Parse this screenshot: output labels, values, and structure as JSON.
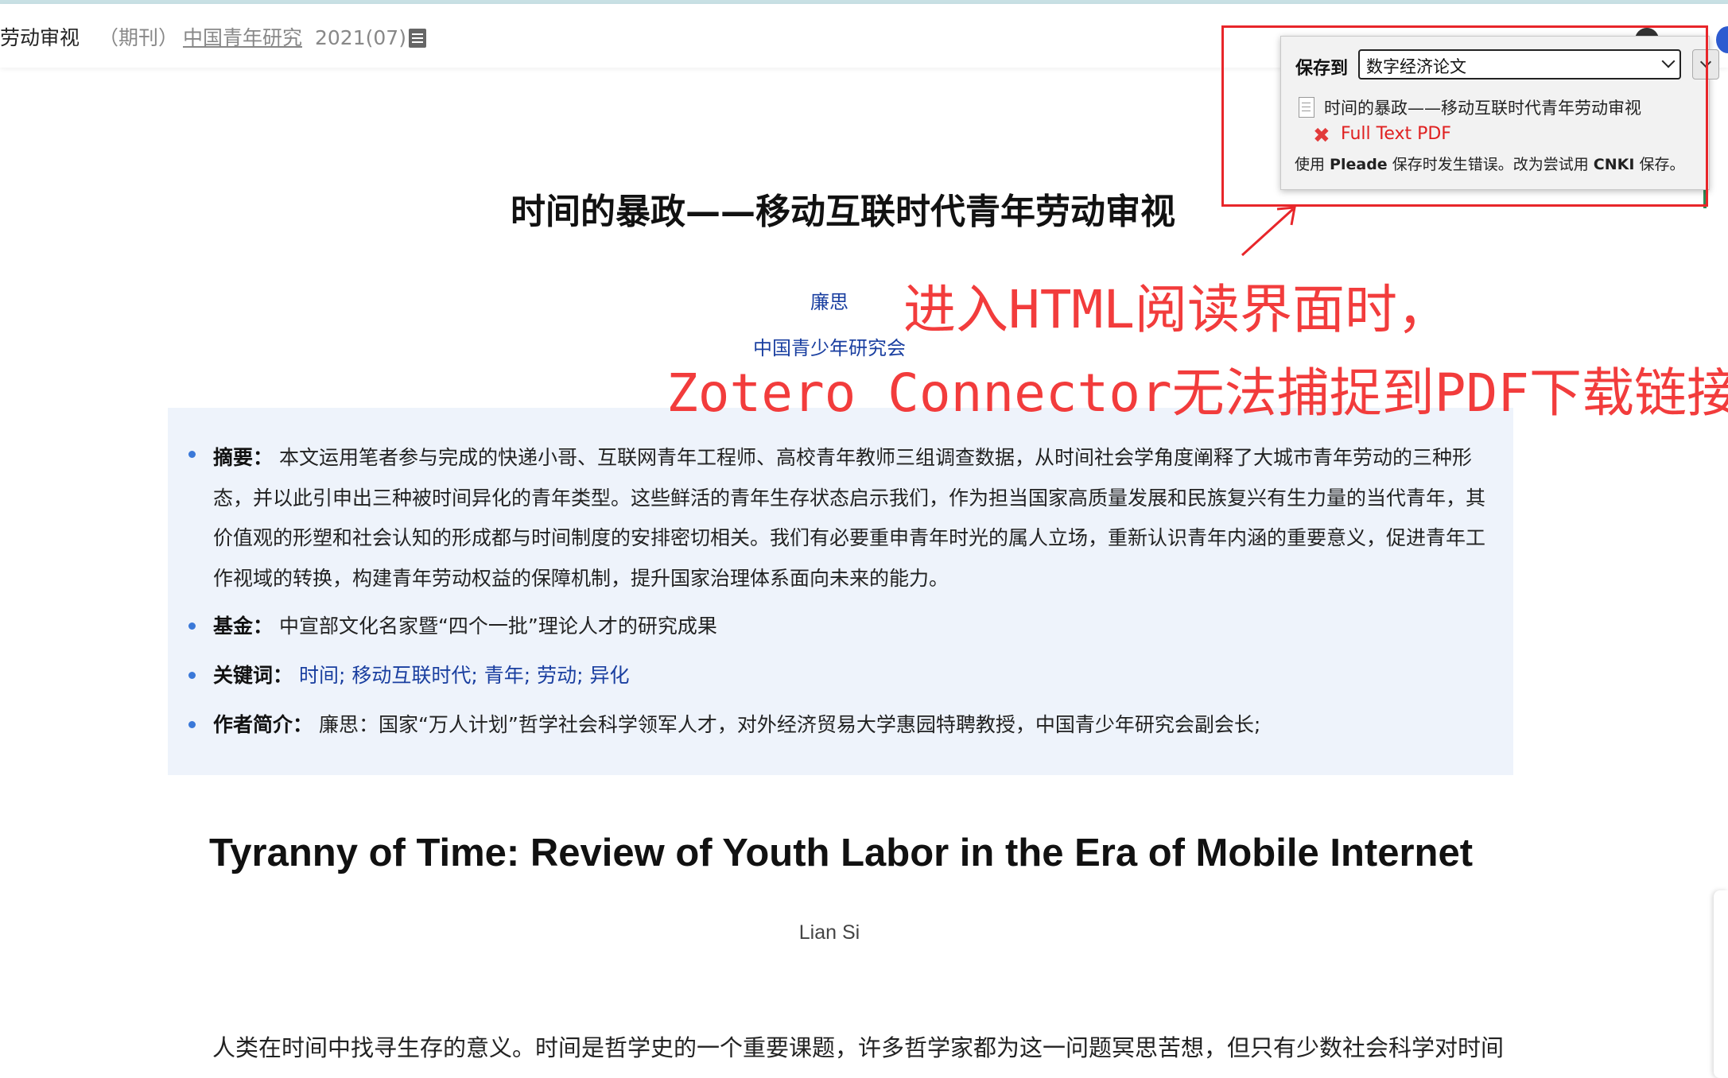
{
  "topbar": {
    "title_fragment": "劳动审视",
    "type": "（期刊）",
    "journal": "中国青年研究",
    "issue": "2021(07)"
  },
  "zotero": {
    "save_to_label": "保存到",
    "collection": "数字经济论文",
    "item_title": "时间的暴政——移动互联时代青年劳动审视",
    "attachment": "Full Text PDF",
    "message_prefix": "使用 ",
    "message_translator": "Pleade",
    "message_mid": " 保存时发生错误。改为尝试用 ",
    "message_fallback": "CNKI",
    "message_suffix": " 保存。"
  },
  "annotation": {
    "line1": "进入HTML阅读界面时，",
    "line2": "Zotero Connector无法捕捉到PDF下载链接",
    "color": "#f23c3c"
  },
  "article": {
    "title_cn": "时间的暴政——移动互联时代青年劳动审视",
    "author": "廉思",
    "organization": "中国青少年研究会",
    "abstract_label": "摘要：",
    "abstract": "本文运用笔者参与完成的快递小哥、互联网青年工程师、高校青年教师三组调查数据，从时间社会学角度阐释了大城市青年劳动的三种形态，并以此引申出三种被时间异化的青年类型。这些鲜活的青年生存状态启示我们，作为担当国家高质量发展和民族复兴有生力量的当代青年，其价值观的形塑和社会认知的形成都与时间制度的安排密切相关。我们有必要重申青年时光的属人立场，重新认识青年内涵的重要意义，促进青年工作视域的转换，构建青年劳动权益的保障机制，提升国家治理体系面向未来的能力。",
    "fund_label": "基金：",
    "fund": "中宣部文化名家暨“四个一批”理论人才的研究成果",
    "keywords_label": "关键词：",
    "keywords": [
      "时间;",
      "移动互联时代;",
      "青年;",
      "劳动;",
      "异化"
    ],
    "bio_label": "作者简介：",
    "bio": "廉思：国家“万人计划”哲学社会科学领军人才，对外经济贸易大学惠园特聘教授，中国青少年研究会副会长;",
    "title_en": "Tyranny of Time: Review of Youth Labor in the Era of Mobile Internet",
    "author_en": "Lian Si",
    "body_start": "人类在时间中找寻生存的意义。时间是哲学史的一个重要课题，许多哲学家都为这一问题冥思苦想，但只有少数社会科学对时间"
  }
}
